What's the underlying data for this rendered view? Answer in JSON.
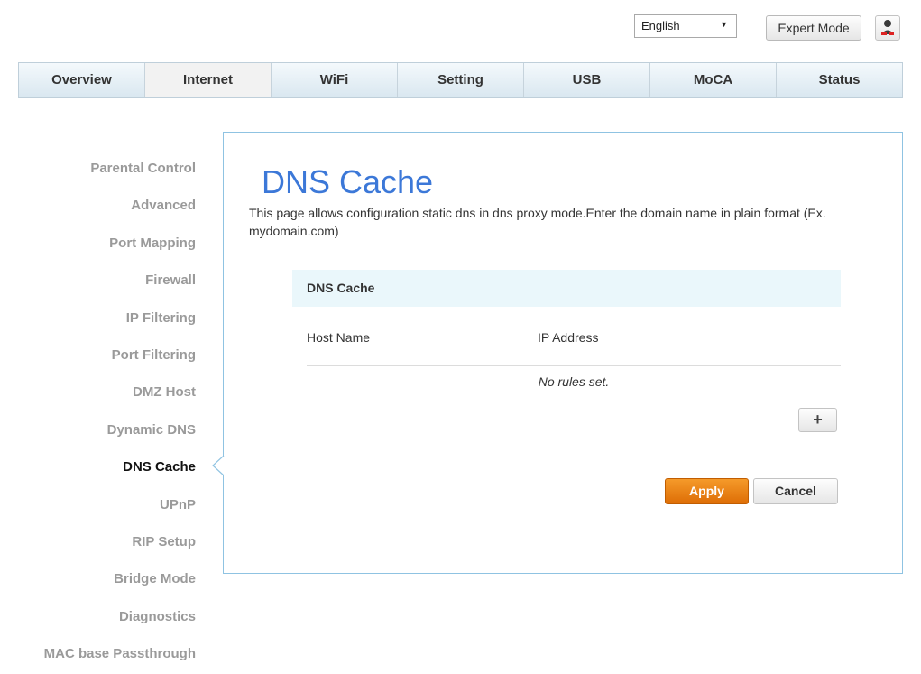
{
  "top": {
    "language": "English",
    "expert_mode": "Expert Mode",
    "user_icon": "user-icon"
  },
  "nav": {
    "tabs": [
      "Overview",
      "Internet",
      "WiFi",
      "Setting",
      "USB",
      "MoCA",
      "Status"
    ],
    "active": "Internet"
  },
  "sidebar": {
    "items": [
      "Parental Control",
      "Advanced",
      "Port Mapping",
      "Firewall",
      "IP Filtering",
      "Port Filtering",
      "DMZ Host",
      "Dynamic DNS",
      "DNS Cache",
      "UPnP",
      "RIP Setup",
      "Bridge Mode",
      "Diagnostics",
      "MAC base Passthrough"
    ],
    "active": "DNS Cache"
  },
  "main": {
    "title": "DNS Cache",
    "description": "This page allows configuration static dns in dns proxy mode.Enter the domain name in plain format (Ex. mydomain.com)",
    "card_title": "DNS Cache",
    "columns": {
      "host": "Host Name",
      "ip": "IP Address"
    },
    "empty_text": "No rules set.",
    "add_icon": "plus-icon",
    "apply": "Apply",
    "cancel": "Cancel"
  },
  "colors": {
    "accent": "#3c78d8",
    "apply": "#e87e10",
    "panel_border": "#8fc3e2"
  }
}
